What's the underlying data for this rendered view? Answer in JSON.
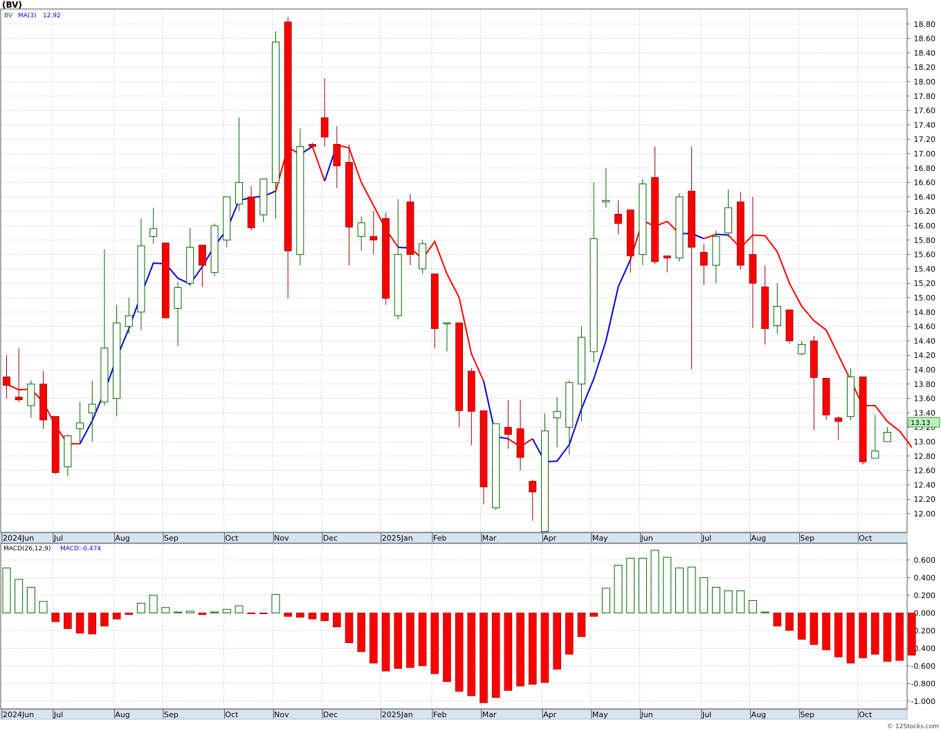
{
  "chart_data": [
    {
      "type": "candlestick",
      "ticker": "(BV)",
      "legend_symbol": "BV",
      "ma_label": "MA(3)",
      "ma_value": "12.92",
      "last_price": "13.13",
      "ylim": [
        11.75,
        19.0
      ],
      "y_ticks": [
        "12.00",
        "12.20",
        "12.40",
        "12.60",
        "12.80",
        "13.00",
        "13.20",
        "13.40",
        "13.60",
        "13.80",
        "14.00",
        "14.20",
        "14.40",
        "14.60",
        "14.80",
        "15.00",
        "15.20",
        "15.40",
        "15.60",
        "15.80",
        "16.00",
        "16.20",
        "16.40",
        "16.60",
        "16.80",
        "17.00",
        "17.20",
        "17.40",
        "17.60",
        "17.80",
        "18.00",
        "18.20",
        "18.40",
        "18.60",
        "18.80"
      ],
      "x_tick_labels": [
        {
          "label": "2024Jun",
          "week": 0
        },
        {
          "label": "Jul",
          "week": 4.2
        },
        {
          "label": "Aug",
          "week": 9.2
        },
        {
          "label": "Sep",
          "week": 13.2
        },
        {
          "label": "Oct",
          "week": 18.2
        },
        {
          "label": "Nov",
          "week": 22.2
        },
        {
          "label": "Dec",
          "week": 26.2
        },
        {
          "label": "2025Jan",
          "week": 31
        },
        {
          "label": "Feb",
          "week": 35.2
        },
        {
          "label": "Mar",
          "week": 39.2
        },
        {
          "label": "Apr",
          "week": 44.2
        },
        {
          "label": "May",
          "week": 48.2
        },
        {
          "label": "Jun",
          "week": 52.2
        },
        {
          "label": "Jul",
          "week": 57.2
        },
        {
          "label": "Aug",
          "week": 61.2
        },
        {
          "label": "Sep",
          "week": 65.2
        },
        {
          "label": "Oct",
          "week": 70
        }
      ],
      "candles": [
        {
          "o": 13.9,
          "h": 14.2,
          "l": 13.6,
          "c": 13.78
        },
        {
          "o": 13.62,
          "h": 14.3,
          "l": 13.55,
          "c": 13.58
        },
        {
          "o": 13.5,
          "h": 13.85,
          "l": 13.33,
          "c": 13.8
        },
        {
          "o": 13.8,
          "h": 13.98,
          "l": 13.18,
          "c": 13.3
        },
        {
          "o": 13.35,
          "h": 13.35,
          "l": 12.55,
          "c": 12.57
        },
        {
          "o": 12.65,
          "h": 13.1,
          "l": 12.52,
          "c": 13.08
        },
        {
          "o": 13.18,
          "h": 13.55,
          "l": 12.97,
          "c": 13.26
        },
        {
          "o": 13.4,
          "h": 13.85,
          "l": 13.0,
          "c": 13.52
        },
        {
          "o": 13.55,
          "h": 15.67,
          "l": 13.5,
          "c": 14.3
        },
        {
          "o": 13.6,
          "h": 14.9,
          "l": 13.35,
          "c": 14.65
        },
        {
          "o": 14.6,
          "h": 15.0,
          "l": 14.5,
          "c": 14.75
        },
        {
          "o": 14.8,
          "h": 16.1,
          "l": 14.55,
          "c": 15.72
        },
        {
          "o": 15.85,
          "h": 16.25,
          "l": 15.75,
          "c": 15.96
        },
        {
          "o": 15.76,
          "h": 15.76,
          "l": 14.71,
          "c": 14.72
        },
        {
          "o": 14.85,
          "h": 15.22,
          "l": 14.33,
          "c": 15.14
        },
        {
          "o": 15.2,
          "h": 15.97,
          "l": 15.16,
          "c": 15.7
        },
        {
          "o": 15.73,
          "h": 15.73,
          "l": 15.15,
          "c": 15.45
        },
        {
          "o": 15.35,
          "h": 16.03,
          "l": 15.3,
          "c": 16.0
        },
        {
          "o": 15.8,
          "h": 16.3,
          "l": 15.7,
          "c": 16.4
        },
        {
          "o": 16.3,
          "h": 17.5,
          "l": 16.2,
          "c": 16.6
        },
        {
          "o": 16.4,
          "h": 16.55,
          "l": 15.93,
          "c": 15.97
        },
        {
          "o": 16.15,
          "h": 16.4,
          "l": 16.05,
          "c": 16.65
        },
        {
          "o": 16.6,
          "h": 18.7,
          "l": 16.1,
          "c": 18.55
        },
        {
          "o": 18.83,
          "h": 18.9,
          "l": 14.99,
          "c": 15.65
        },
        {
          "o": 15.6,
          "h": 17.35,
          "l": 15.45,
          "c": 17.1
        },
        {
          "o": 17.13,
          "h": 17.15,
          "l": 17.08,
          "c": 17.1
        },
        {
          "o": 17.5,
          "h": 18.05,
          "l": 17.1,
          "c": 17.23
        },
        {
          "o": 17.13,
          "h": 17.38,
          "l": 16.52,
          "c": 16.83
        },
        {
          "o": 16.88,
          "h": 17.13,
          "l": 15.45,
          "c": 15.98
        },
        {
          "o": 15.85,
          "h": 16.13,
          "l": 15.65,
          "c": 16.04
        },
        {
          "o": 15.85,
          "h": 16.2,
          "l": 15.6,
          "c": 15.8
        },
        {
          "o": 16.1,
          "h": 16.18,
          "l": 14.9,
          "c": 14.99
        },
        {
          "o": 14.75,
          "h": 16.37,
          "l": 14.7,
          "c": 15.6
        },
        {
          "o": 16.33,
          "h": 16.44,
          "l": 15.45,
          "c": 15.6
        },
        {
          "o": 15.4,
          "h": 15.8,
          "l": 15.33,
          "c": 15.75
        },
        {
          "o": 15.33,
          "h": 15.33,
          "l": 14.3,
          "c": 14.57
        },
        {
          "o": 14.65,
          "h": 14.65,
          "l": 14.25,
          "c": 14.65
        },
        {
          "o": 14.65,
          "h": 14.65,
          "l": 13.2,
          "c": 13.43
        },
        {
          "o": 13.98,
          "h": 14.02,
          "l": 12.95,
          "c": 13.42
        },
        {
          "o": 13.43,
          "h": 13.43,
          "l": 12.13,
          "c": 12.37
        },
        {
          "o": 12.08,
          "h": 13.25,
          "l": 12.05,
          "c": 13.25
        },
        {
          "o": 13.2,
          "h": 13.58,
          "l": 12.9,
          "c": 13.1
        },
        {
          "o": 13.18,
          "h": 13.58,
          "l": 12.6,
          "c": 12.78
        },
        {
          "o": 12.45,
          "h": 12.47,
          "l": 11.9,
          "c": 12.3
        },
        {
          "o": 11.75,
          "h": 13.39,
          "l": 11.75,
          "c": 13.15
        },
        {
          "o": 13.33,
          "h": 13.62,
          "l": 12.92,
          "c": 13.42
        },
        {
          "o": 13.2,
          "h": 13.85,
          "l": 12.82,
          "c": 13.82
        },
        {
          "o": 13.8,
          "h": 14.6,
          "l": 13.28,
          "c": 14.45
        },
        {
          "o": 14.25,
          "h": 16.6,
          "l": 14.1,
          "c": 15.82
        },
        {
          "o": 16.33,
          "h": 16.8,
          "l": 16.25,
          "c": 16.35
        },
        {
          "o": 16.16,
          "h": 16.35,
          "l": 15.88,
          "c": 16.03
        },
        {
          "o": 16.22,
          "h": 16.22,
          "l": 15.35,
          "c": 15.58
        },
        {
          "o": 15.6,
          "h": 16.65,
          "l": 15.45,
          "c": 16.58
        },
        {
          "o": 16.67,
          "h": 17.1,
          "l": 15.47,
          "c": 15.5
        },
        {
          "o": 15.58,
          "h": 15.58,
          "l": 15.35,
          "c": 15.55
        },
        {
          "o": 15.55,
          "h": 16.45,
          "l": 15.5,
          "c": 16.4
        },
        {
          "o": 16.48,
          "h": 17.1,
          "l": 14.01,
          "c": 15.7
        },
        {
          "o": 15.63,
          "h": 15.75,
          "l": 15.18,
          "c": 15.45
        },
        {
          "o": 15.45,
          "h": 15.93,
          "l": 15.2,
          "c": 15.85
        },
        {
          "o": 15.9,
          "h": 16.5,
          "l": 15.84,
          "c": 16.25
        },
        {
          "o": 16.33,
          "h": 16.47,
          "l": 15.39,
          "c": 15.45
        },
        {
          "o": 15.6,
          "h": 16.4,
          "l": 14.58,
          "c": 15.2
        },
        {
          "o": 15.15,
          "h": 15.45,
          "l": 14.35,
          "c": 14.57
        },
        {
          "o": 14.61,
          "h": 15.2,
          "l": 14.5,
          "c": 14.88
        },
        {
          "o": 14.83,
          "h": 14.83,
          "l": 14.36,
          "c": 14.4
        },
        {
          "o": 14.22,
          "h": 14.4,
          "l": 14.2,
          "c": 14.35
        },
        {
          "o": 14.4,
          "h": 14.47,
          "l": 13.16,
          "c": 13.89
        },
        {
          "o": 13.88,
          "h": 13.88,
          "l": 13.3,
          "c": 13.37
        },
        {
          "o": 13.33,
          "h": 13.35,
          "l": 13.02,
          "c": 13.28
        },
        {
          "o": 13.35,
          "h": 14.02,
          "l": 13.3,
          "c": 13.9
        },
        {
          "o": 13.9,
          "h": 13.9,
          "l": 12.68,
          "c": 12.72
        },
        {
          "o": 12.77,
          "h": 13.37,
          "l": 12.77,
          "c": 12.87
        },
        {
          "o": 13.0,
          "h": 13.2,
          "l": 13.0,
          "c": 13.13
        }
      ],
      "ma3": [
        {
          "w": 0,
          "v": 13.8
        },
        {
          "w": 1,
          "v": 13.72
        },
        {
          "w": 2,
          "v": 13.73
        },
        {
          "w": 3,
          "v": 13.55
        },
        {
          "w": 4,
          "v": 13.22
        },
        {
          "w": 5,
          "v": 12.97
        },
        {
          "w": 6,
          "v": 12.97
        },
        {
          "w": 7,
          "v": 13.29
        },
        {
          "w": 8,
          "v": 13.69
        },
        {
          "w": 9,
          "v": 14.16
        },
        {
          "w": 10,
          "v": 14.57
        },
        {
          "w": 11,
          "v": 15.04
        },
        {
          "w": 12,
          "v": 15.48
        },
        {
          "w": 13,
          "v": 15.47
        },
        {
          "w": 14,
          "v": 15.27
        },
        {
          "w": 15,
          "v": 15.19
        },
        {
          "w": 16,
          "v": 15.43
        },
        {
          "w": 17,
          "v": 15.72
        },
        {
          "w": 18,
          "v": 15.94
        },
        {
          "w": 19,
          "v": 16.35
        },
        {
          "w": 20,
          "v": 16.39
        },
        {
          "w": 21,
          "v": 16.41
        },
        {
          "w": 22,
          "v": 16.48
        },
        {
          "w": 23,
          "v": 17.09
        },
        {
          "w": 24,
          "v": 16.99
        },
        {
          "w": 25,
          "v": 17.1
        },
        {
          "w": 26,
          "v": 16.62
        },
        {
          "w": 27,
          "v": 17.12
        },
        {
          "w": 28,
          "v": 17.08
        },
        {
          "w": 29,
          "v": 16.6
        },
        {
          "w": 30,
          "v": 16.28
        },
        {
          "w": 31,
          "v": 15.95
        },
        {
          "w": 32,
          "v": 15.7
        },
        {
          "w": 33,
          "v": 15.69
        },
        {
          "w": 34,
          "v": 15.54
        },
        {
          "w": 35,
          "v": 15.78
        },
        {
          "w": 36,
          "v": 15.33
        },
        {
          "w": 37,
          "v": 15.0
        },
        {
          "w": 38,
          "v": 14.22
        },
        {
          "w": 39,
          "v": 13.84
        },
        {
          "w": 40,
          "v": 13.07
        },
        {
          "w": 41,
          "v": 13.04
        },
        {
          "w": 42,
          "v": 12.93
        },
        {
          "w": 43,
          "v": 13.04
        },
        {
          "w": 44,
          "v": 12.72
        },
        {
          "w": 45,
          "v": 12.73
        },
        {
          "w": 46,
          "v": 12.96
        },
        {
          "w": 47,
          "v": 13.46
        },
        {
          "w": 48,
          "v": 13.87
        },
        {
          "w": 49,
          "v": 14.4
        },
        {
          "w": 50,
          "v": 15.15
        },
        {
          "w": 51,
          "v": 15.53
        },
        {
          "w": 52,
          "v": 16.07
        },
        {
          "w": 53,
          "v": 15.99
        },
        {
          "w": 54,
          "v": 16.06
        },
        {
          "w": 55,
          "v": 15.89
        },
        {
          "w": 56,
          "v": 15.89
        },
        {
          "w": 57,
          "v": 15.82
        },
        {
          "w": 58,
          "v": 15.88
        },
        {
          "w": 59,
          "v": 15.87
        },
        {
          "w": 60,
          "v": 15.69
        },
        {
          "w": 61,
          "v": 15.87
        },
        {
          "w": 62,
          "v": 15.86
        },
        {
          "w": 63,
          "v": 15.64
        },
        {
          "w": 64,
          "v": 15.2
        },
        {
          "w": 65,
          "v": 14.88
        },
        {
          "w": 66,
          "v": 14.68
        },
        {
          "w": 67,
          "v": 14.55
        },
        {
          "w": 68,
          "v": 14.2
        },
        {
          "w": 69,
          "v": 13.85
        },
        {
          "w": 70,
          "v": 13.5
        },
        {
          "w": 71,
          "v": 13.5
        },
        {
          "w": 72,
          "v": 13.28
        },
        {
          "w": 73,
          "v": 13.15
        },
        {
          "w": 74,
          "v": 12.92
        }
      ],
      "ma3_segments": [
        {
          "from": 0,
          "to": 6,
          "color": "#ff0000"
        },
        {
          "from": 6,
          "to": 22,
          "color": "#0000dd"
        },
        {
          "from": 22,
          "to": 24,
          "color": "#ff0000"
        },
        {
          "from": 24,
          "to": 25,
          "color": "#0000dd"
        },
        {
          "from": 25,
          "to": 26,
          "color": "#ff0000"
        },
        {
          "from": 26,
          "to": 27,
          "color": "#0000dd"
        },
        {
          "from": 27,
          "to": 32,
          "color": "#ff0000"
        },
        {
          "from": 32,
          "to": 33,
          "color": "#0000dd"
        },
        {
          "from": 33,
          "to": 39,
          "color": "#ff0000"
        },
        {
          "from": 39,
          "to": 41,
          "color": "#0000dd"
        },
        {
          "from": 41,
          "to": 43,
          "color": "#ff0000"
        },
        {
          "from": 43,
          "to": 47,
          "color": "#0000dd"
        },
        {
          "from": 47,
          "to": 51,
          "color": "#0000dd"
        },
        {
          "from": 51,
          "to": 55,
          "color": "#ff0000"
        },
        {
          "from": 55,
          "to": 57,
          "color": "#0000dd"
        },
        {
          "from": 57,
          "to": 58,
          "color": "#ff0000"
        },
        {
          "from": 58,
          "to": 59,
          "color": "#0000dd"
        },
        {
          "from": 59,
          "to": 74,
          "color": "#ff0000"
        }
      ]
    },
    {
      "type": "bar",
      "label": "MACD(26,12,9)",
      "value_label": "MACD:-0.474",
      "ylim": [
        -1.08,
        0.78
      ],
      "y_ticks": [
        "0.600",
        "0.400",
        "0.200",
        "0.000",
        "-0.200",
        "-0.400",
        "-0.600",
        "-0.800",
        "-1.000"
      ],
      "values": [
        0.51,
        0.38,
        0.29,
        0.13,
        -0.1,
        -0.18,
        -0.23,
        -0.24,
        -0.15,
        -0.07,
        -0.02,
        0.11,
        0.2,
        0.06,
        0.01,
        0.02,
        -0.02,
        0.01,
        0.04,
        0.08,
        -0.01,
        -0.01,
        0.21,
        -0.04,
        -0.05,
        -0.07,
        -0.09,
        -0.16,
        -0.34,
        -0.44,
        -0.57,
        -0.66,
        -0.63,
        -0.62,
        -0.6,
        -0.69,
        -0.78,
        -0.89,
        -0.94,
        -1.02,
        -0.96,
        -0.88,
        -0.83,
        -0.81,
        -0.79,
        -0.64,
        -0.47,
        -0.27,
        -0.04,
        0.28,
        0.54,
        0.62,
        0.62,
        0.71,
        0.63,
        0.51,
        0.52,
        0.4,
        0.29,
        0.25,
        0.25,
        0.14,
        0.01,
        -0.15,
        -0.2,
        -0.3,
        -0.36,
        -0.42,
        -0.5,
        -0.57,
        -0.51,
        -0.47,
        -0.55,
        -0.54,
        -0.48
      ],
      "positive_color": "#006600",
      "negative_color": "#ff0000"
    }
  ],
  "footer": {
    "copyright": "© 12Stocks.com"
  },
  "colors": {
    "up_candle_border": "#006600",
    "down_candle_fill": "#ff0000",
    "axis_strip": "#d8e4ef",
    "grid": "#b4b4b4",
    "last_price_box": "#bbf0bb"
  }
}
